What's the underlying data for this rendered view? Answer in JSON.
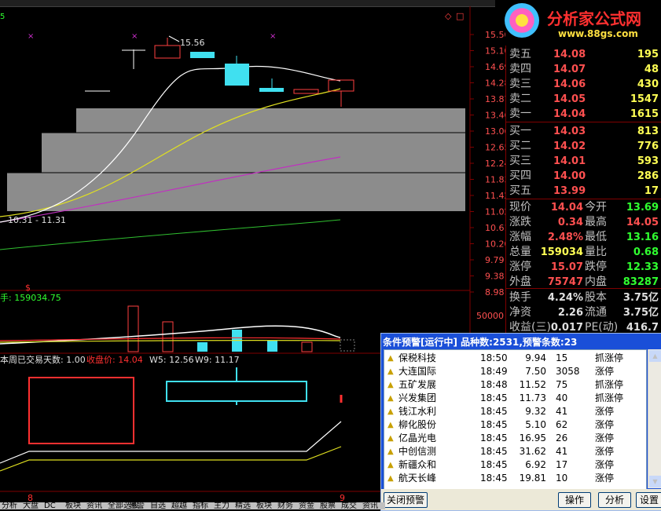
{
  "logo": {
    "text": "分析家公式网",
    "url": "www.88gs.com"
  },
  "chart_top": {
    "period_marker": "5",
    "price_axis": [
      "15.50",
      "15.10",
      "14.69",
      "14.28",
      "13.87",
      "13.46",
      "13.06",
      "12.65",
      "12.24",
      "11.83",
      "11.42",
      "11.02",
      "10.61",
      "10.20",
      "9.79",
      "9.38",
      "8.98"
    ],
    "high_label": "15.56",
    "range_label": "10.31 - 11.31",
    "dollar_marker": "$"
  },
  "chart_volume": {
    "label": "手: 159034.75",
    "axis_top": "50000"
  },
  "chart_indicator": {
    "label_prefix": "本周已交易天数: 1.00",
    "label_close": "收盘价: 14.04",
    "label_w5": "W5: 12.56",
    "label_w9": "W9: 11.17"
  },
  "date_markers": {
    "left": "8",
    "right": "9"
  },
  "quote": {
    "asks": [
      {
        "label": "卖五",
        "price": "14.08",
        "vol": "195"
      },
      {
        "label": "卖四",
        "price": "14.07",
        "vol": "48"
      },
      {
        "label": "卖三",
        "price": "14.06",
        "vol": "430"
      },
      {
        "label": "卖二",
        "price": "14.05",
        "vol": "1547"
      },
      {
        "label": "卖一",
        "price": "14.04",
        "vol": "1615"
      }
    ],
    "bids": [
      {
        "label": "买一",
        "price": "14.03",
        "vol": "813"
      },
      {
        "label": "买二",
        "price": "14.02",
        "vol": "776"
      },
      {
        "label": "买三",
        "price": "14.01",
        "vol": "593"
      },
      {
        "label": "买四",
        "price": "14.00",
        "vol": "286"
      },
      {
        "label": "买五",
        "price": "13.99",
        "vol": "17"
      }
    ],
    "stats": [
      {
        "l1": "现价",
        "v1": "14.04",
        "c1": "red",
        "l2": "今开",
        "v2": "13.69",
        "c2": "green"
      },
      {
        "l1": "涨跌",
        "v1": "0.34",
        "c1": "red",
        "l2": "最高",
        "v2": "14.05",
        "c2": "red"
      },
      {
        "l1": "涨幅",
        "v1": "2.48%",
        "c1": "red",
        "l2": "最低",
        "v2": "13.16",
        "c2": "green"
      },
      {
        "l1": "总量",
        "v1": "159034",
        "c1": "yellow",
        "l2": "量比",
        "v2": "0.68",
        "c2": "green"
      },
      {
        "l1": "涨停",
        "v1": "15.07",
        "c1": "red",
        "l2": "跌停",
        "v2": "12.33",
        "c2": "green"
      },
      {
        "l1": "外盘",
        "v1": "75747",
        "c1": "red",
        "l2": "内盘",
        "v2": "83287",
        "c2": "green"
      }
    ],
    "stats2": [
      {
        "l1": "换手",
        "v1": "4.24%",
        "l2": "股本",
        "v2": "3.75亿"
      },
      {
        "l1": "净资",
        "v1": "2.26",
        "l2": "流通",
        "v2": "3.75亿"
      },
      {
        "l1": "收益(三)",
        "v1": "0.017",
        "l2": "PE(动)",
        "v2": "416.7"
      }
    ]
  },
  "alert": {
    "title": "条件预警[运行中] 品种数:2531,预警条数:23",
    "rows": [
      {
        "name": "保税科技",
        "time": "18:50",
        "price": "9.94",
        "vol": "15",
        "type": "抓涨停"
      },
      {
        "name": "大连国际",
        "time": "18:49",
        "price": "7.50",
        "vol": "3058",
        "type": "涨停"
      },
      {
        "name": "五矿发展",
        "time": "18:48",
        "price": "11.52",
        "vol": "75",
        "type": "抓涨停"
      },
      {
        "name": "兴发集团",
        "time": "18:45",
        "price": "11.73",
        "vol": "40",
        "type": "抓涨停"
      },
      {
        "name": "钱江水利",
        "time": "18:45",
        "price": "9.32",
        "vol": "41",
        "type": "涨停"
      },
      {
        "name": "柳化股份",
        "time": "18:45",
        "price": "5.10",
        "vol": "62",
        "type": "涨停"
      },
      {
        "name": "亿晶光电",
        "time": "18:45",
        "price": "16.95",
        "vol": "26",
        "type": "涨停"
      },
      {
        "name": "中创信测",
        "time": "18:45",
        "price": "31.62",
        "vol": "41",
        "type": "涨停"
      },
      {
        "name": "新疆众和",
        "time": "18:45",
        "price": "6.92",
        "vol": "17",
        "type": "涨停"
      },
      {
        "name": "航天长峰",
        "time": "18:45",
        "price": "19.81",
        "vol": "10",
        "type": "涨停"
      }
    ],
    "close_btn": "关闭预警",
    "op_btn": "操作",
    "analyze_btn": "分析",
    "settings_btn": "设置"
  },
  "tabs": [
    "分析",
    "大盘",
    "DC",
    "板块",
    "资讯",
    "全部选股",
    "预警",
    "自选",
    "超越",
    "指标",
    "主力",
    "精选",
    "板块",
    "财务",
    "资金",
    "股票",
    "成交",
    "资讯"
  ]
}
